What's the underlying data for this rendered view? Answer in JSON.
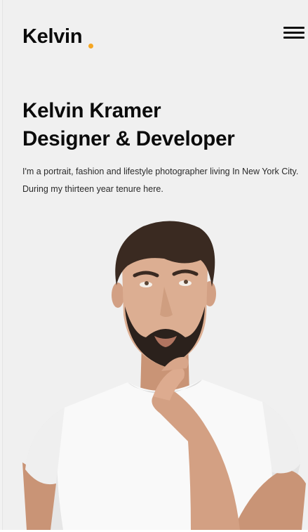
{
  "header": {
    "logo_text": "Kelvin",
    "logo_dot_color": "#f5a623",
    "menu_icon": "hamburger-menu-icon"
  },
  "hero": {
    "name_line": "Kelvin Kramer",
    "role_line": "Designer & Developer",
    "bio": "I'm a portrait, fashion and lifestyle photographer living In New York City. During my thirteen year tenure here.",
    "portrait_image": "man-in-white-tshirt-thinking-portrait"
  },
  "colors": {
    "background": "#f0f0f0",
    "text": "#0b0b0b",
    "accent": "#f5a623"
  }
}
